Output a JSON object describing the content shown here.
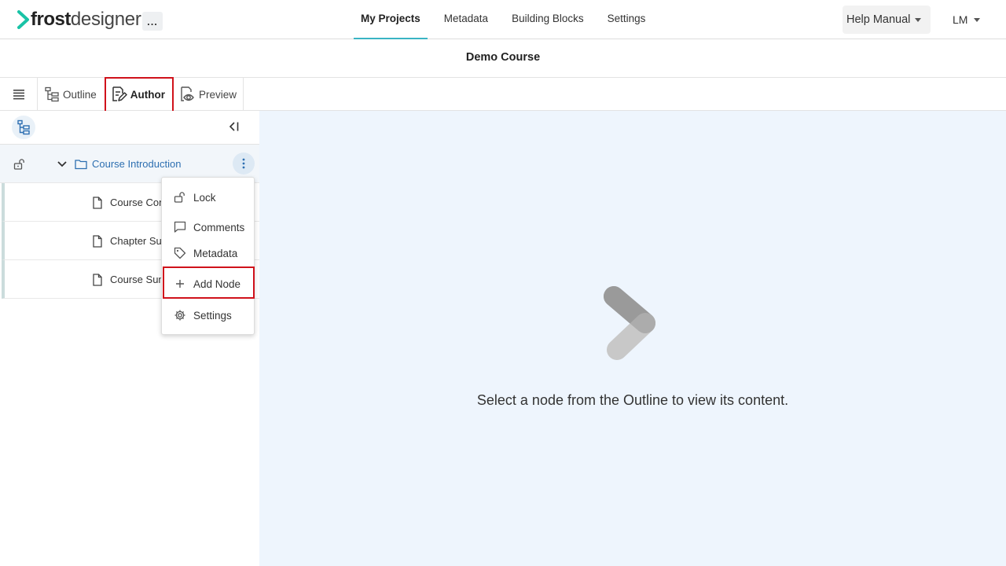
{
  "app": {
    "logo_bold": "frost",
    "logo_light": "designer",
    "more_label": "...",
    "accent_color": "#3ab4c4"
  },
  "nav": {
    "items": [
      {
        "label": "My Projects",
        "active": true
      },
      {
        "label": "Metadata",
        "active": false
      },
      {
        "label": "Building Blocks",
        "active": false
      },
      {
        "label": "Settings",
        "active": false
      }
    ],
    "help_label": "Help Manual",
    "user_initials": "LM"
  },
  "course": {
    "title": "Demo Course"
  },
  "modes": {
    "tabs": [
      {
        "label": "Outline",
        "icon": "outline-tree-icon"
      },
      {
        "label": "Author",
        "icon": "author-edit-icon",
        "active": true
      },
      {
        "label": "Preview",
        "icon": "preview-eye-icon"
      }
    ]
  },
  "outline": {
    "root": {
      "label": "Course Introduction",
      "icon": "folder-icon"
    },
    "children": [
      {
        "label": "Course Cont"
      },
      {
        "label": "Chapter Sum"
      },
      {
        "label": "Course Sum"
      }
    ]
  },
  "context_menu": {
    "items": [
      {
        "label": "Lock",
        "icon": "unlock-icon"
      },
      {
        "label": "Comments",
        "icon": "comment-icon"
      },
      {
        "label": "Metadata",
        "icon": "tag-icon"
      },
      {
        "label": "Add Node",
        "icon": "plus-icon"
      },
      {
        "label": "Settings",
        "icon": "gear-icon"
      }
    ]
  },
  "main": {
    "empty_message": "Select a node from the Outline to view its content."
  },
  "colors": {
    "highlight": "#d0121b",
    "link": "#2d6fb1",
    "main_bg": "#eef5fd"
  }
}
